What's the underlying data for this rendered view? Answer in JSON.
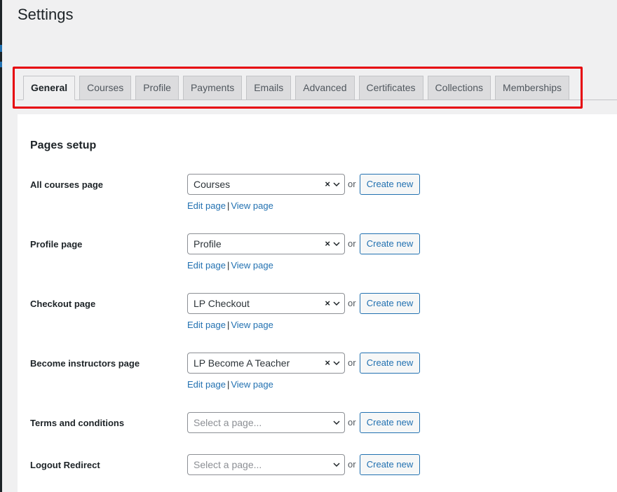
{
  "header": {
    "title": "Settings"
  },
  "tabs": [
    {
      "label": "General",
      "active": true
    },
    {
      "label": "Courses",
      "active": false
    },
    {
      "label": "Profile",
      "active": false
    },
    {
      "label": "Payments",
      "active": false
    },
    {
      "label": "Emails",
      "active": false
    },
    {
      "label": "Advanced",
      "active": false
    },
    {
      "label": "Certificates",
      "active": false
    },
    {
      "label": "Collections",
      "active": false
    },
    {
      "label": "Memberships",
      "active": false
    }
  ],
  "highlight_color": "#e6000b",
  "accent_color": "#2271b1",
  "section": {
    "title": "Pages setup",
    "or_label": "or",
    "create_label": "Create new",
    "edit_label": "Edit page",
    "view_label": "View page",
    "separator": "|",
    "clear_icon": "×",
    "rows": [
      {
        "label": "All courses page",
        "value": "Courses",
        "placeholder": "",
        "has_value": true
      },
      {
        "label": "Profile page",
        "value": "Profile",
        "placeholder": "",
        "has_value": true
      },
      {
        "label": "Checkout page",
        "value": "LP Checkout",
        "placeholder": "",
        "has_value": true
      },
      {
        "label": "Become instructors page",
        "value": "LP Become A Teacher",
        "placeholder": "",
        "has_value": true
      },
      {
        "label": "Terms and conditions",
        "value": "",
        "placeholder": "Select a page...",
        "has_value": false
      },
      {
        "label": "Logout Redirect",
        "value": "",
        "placeholder": "Select a page...",
        "has_value": false
      }
    ]
  }
}
